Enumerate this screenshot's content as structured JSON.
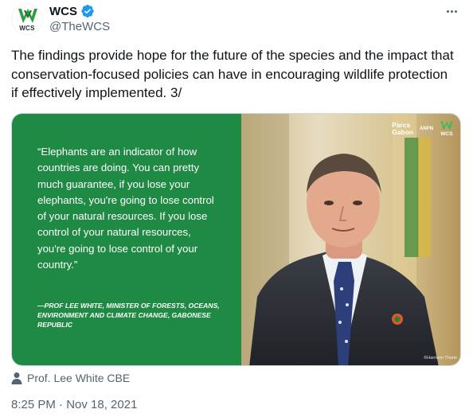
{
  "author": {
    "display_name": "WCS",
    "handle": "@TheWCS",
    "avatar_text": "WCS",
    "verified": true
  },
  "tweet": {
    "text": "The findings provide hope for the future of the species and the impact that conservation-focused policies can have in encouraging wildlife protection if effectively implemented. 3/"
  },
  "media": {
    "quote": "“Elephants are an indicator of how countries are doing. You can pretty much guarantee, if you lose your elephants, you're going to lose control of your natural resources. If you lose control of your natural resources, you're going to lose control of your country.”",
    "attribution": "—PROF LEE WHITE, MINISTER OF FORESTS, OCEANS, ENVIRONMENT AND CLIMATE CHANGE, GABONESE REPUBLIC",
    "logo_parcs_line1": "Parcs",
    "logo_parcs_line2": "Gabon",
    "logo_anpn": "ANPN",
    "logo_wcs": "WCS",
    "photo_credit": "©Harrison Thane",
    "panel_color": "#1f8a43"
  },
  "tagged_user": "Prof. Lee White CBE",
  "timestamp": "8:25 PM · Nov 18, 2021",
  "icons": {
    "more": "more-icon",
    "verified": "verified-badge-icon",
    "person": "person-icon"
  }
}
